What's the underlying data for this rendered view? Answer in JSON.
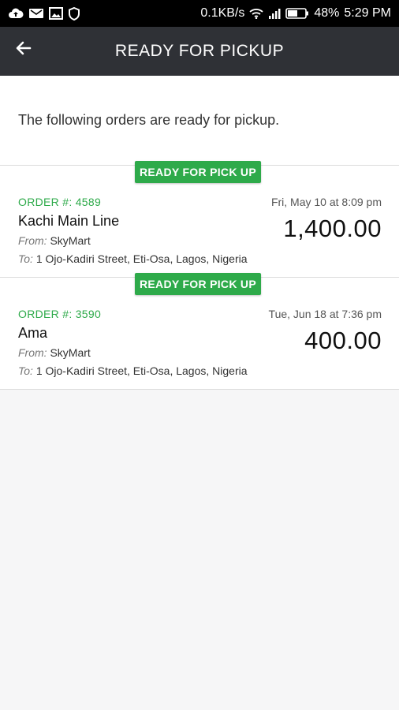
{
  "status_bar": {
    "network_speed": "0.1KB/s",
    "battery": "48%",
    "time": "5:29 PM"
  },
  "app_bar": {
    "title": "READY FOR PICKUP",
    "back_icon": "arrow-left-icon"
  },
  "intro_text": "The following orders are ready for pickup.",
  "labels": {
    "from": "From:",
    "to": "To:"
  },
  "orders": [
    {
      "badge": "READY FOR PICK UP",
      "order_number": "ORDER #: 4589",
      "date": "Fri, May 10 at 8:09 pm",
      "customer": "Kachi Main Line",
      "amount": "1,400.00",
      "from": "SkyMart",
      "to": "1 Ojo-Kadiri Street, Eti-Osa, Lagos, Nigeria"
    },
    {
      "badge": "READY FOR PICK UP",
      "order_number": "ORDER #: 3590",
      "date": "Tue, Jun 18 at 7:36 pm",
      "customer": "Ama",
      "amount": "400.00",
      "from": "SkyMart",
      "to": "1 Ojo-Kadiri Street, Eti-Osa, Lagos, Nigeria"
    }
  ],
  "colors": {
    "accent_green": "#2eaa4a",
    "app_bar": "#2f3136",
    "status_bar": "#000000"
  }
}
